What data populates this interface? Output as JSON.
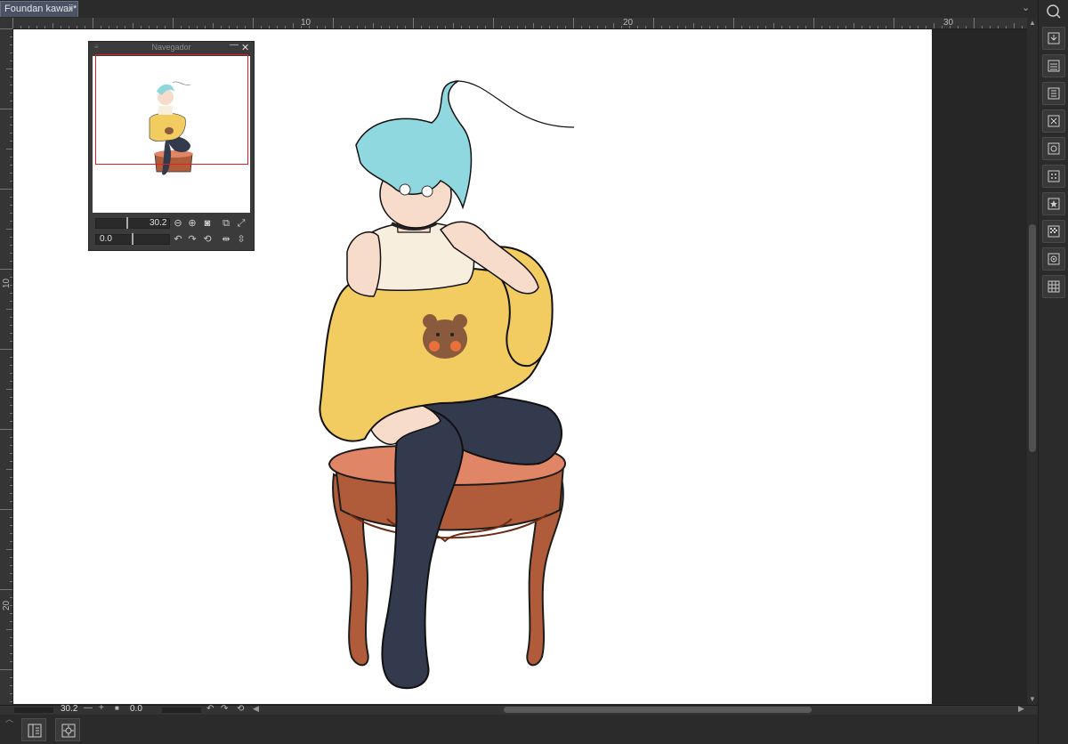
{
  "document": {
    "tab_label": "Foundan kawaii*",
    "tab_close": "●"
  },
  "tab_menu": "⌄",
  "rulers": {
    "top_labels": [
      "10",
      "20",
      "30"
    ],
    "left_labels": [
      "10",
      "20"
    ]
  },
  "navigator": {
    "title": "Navegador",
    "grip": "≡",
    "minimize": "—",
    "close": "✕",
    "zoom_value": "30.2",
    "rotate_value": "0.0"
  },
  "status": {
    "zoom_value": "30.2",
    "zoom_minus": "—",
    "zoom_plus": "+",
    "zoom_fit": "■",
    "rotate_value": "0.0"
  },
  "right_toolbar": {
    "icons": [
      "navigator-panel-icon",
      "import-icon",
      "layer-properties-icon",
      "history-icon",
      "delete-icon",
      "material-icon",
      "tone-icon",
      "favorite-material-icon",
      "texture-icon",
      "image-material-icon",
      "grid-material-icon"
    ]
  },
  "colors": {
    "app_bg": "#2b2b2b",
    "tab_active": "#4a5263",
    "paper": "#ffffff",
    "nav_view_rect": "#e02020",
    "hair": "#8fd8df",
    "sweater": "#f2cc60",
    "stockings": "#333a4d",
    "stool": "#b05c3a",
    "cushion": "#e08566"
  }
}
